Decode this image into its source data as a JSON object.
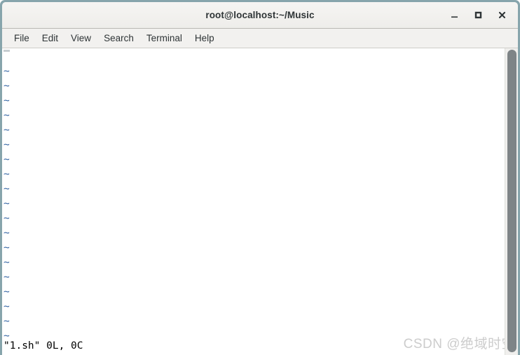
{
  "window": {
    "title": "root@localhost:~/Music",
    "border_color": "#87a5ac",
    "titlebar_bg": "#f2f1ef",
    "controls": [
      {
        "name": "minimize",
        "glyph": "_"
      },
      {
        "name": "maximize",
        "glyph": "□"
      },
      {
        "name": "close",
        "glyph": "×"
      }
    ]
  },
  "menubar": {
    "items": [
      {
        "label": "File"
      },
      {
        "label": "Edit"
      },
      {
        "label": "View"
      },
      {
        "label": "Search"
      },
      {
        "label": "Terminal"
      },
      {
        "label": "Help"
      }
    ]
  },
  "terminal": {
    "app": "vim",
    "text_color": "#000000",
    "background": "#ffffff",
    "tilde_color": "#3465a4",
    "tilde_char": "~",
    "empty_line_count": 19,
    "first_line": "",
    "status_line": "\"1.sh\" 0L, 0C"
  },
  "scrollbar": {
    "thumb_color": "#7e8487",
    "track_color": "#f0efed"
  },
  "watermark": {
    "text": "CSDN @绝域时空",
    "color": "#cccccc"
  }
}
